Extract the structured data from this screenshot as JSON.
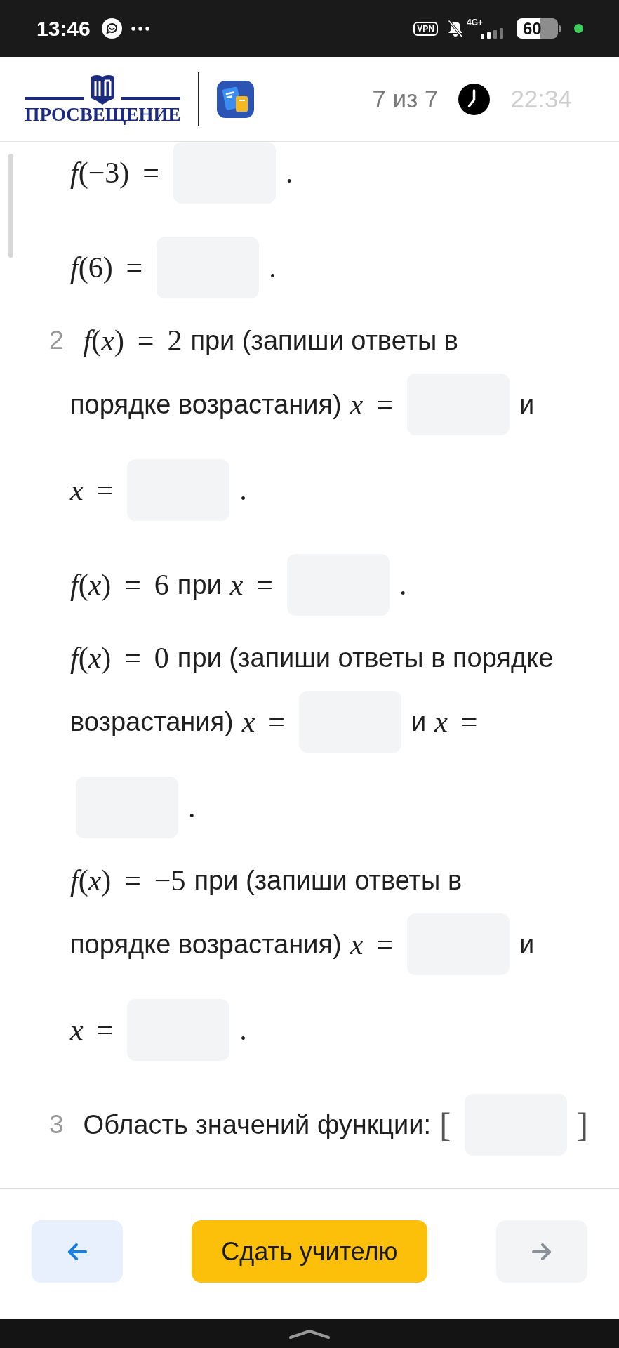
{
  "status_bar": {
    "time": "13:46",
    "vpn": "VPN",
    "network": "4G+",
    "battery": "60"
  },
  "header": {
    "logo_text": "ПРОСВЕЩЕНИЕ",
    "progress": {
      "label": "7 из 7",
      "disabled": true
    },
    "timer": "22:34"
  },
  "questions": [
    {
      "parts": [
        {
          "lines": [
            [
              {
                "kind": "math",
                "text": "*f*(−3) ="
              },
              {
                "kind": "blank"
              },
              {
                "kind": "math",
                "text": "."
              }
            ]
          ]
        },
        {
          "lines": [
            [
              {
                "kind": "math",
                "text": "*f*(6) ="
              },
              {
                "kind": "blank"
              },
              {
                "kind": "math",
                "text": "."
              }
            ]
          ]
        }
      ]
    },
    {
      "number": "2",
      "parts": [
        {
          "lines": [
            [
              {
                "kind": "math",
                "text": "*f*(*x*) = 2"
              },
              {
                "kind": "text",
                "text": "при (запиши ответы в"
              }
            ],
            [
              {
                "kind": "text",
                "text": "порядке возрастания)"
              },
              {
                "kind": "math",
                "text": "*x* ="
              },
              {
                "kind": "blank"
              },
              {
                "kind": "text",
                "text": "и"
              }
            ],
            [
              {
                "kind": "math",
                "text": "*x* ="
              },
              {
                "kind": "blank"
              },
              {
                "kind": "math",
                "text": "."
              }
            ]
          ]
        },
        {
          "lines": [
            [
              {
                "kind": "math",
                "text": "*f*(*x*) = 6"
              },
              {
                "kind": "text",
                "text": "при"
              },
              {
                "kind": "math",
                "text": "*x* ="
              },
              {
                "kind": "blank"
              },
              {
                "kind": "math",
                "text": "."
              }
            ]
          ]
        },
        {
          "lines": [
            [
              {
                "kind": "math",
                "text": "*f*(*x*) = 0"
              },
              {
                "kind": "text",
                "text": "при (запиши ответы в порядке"
              }
            ],
            [
              {
                "kind": "text",
                "text": "возрастания)"
              },
              {
                "kind": "math",
                "text": "*x* ="
              },
              {
                "kind": "blank"
              },
              {
                "kind": "text",
                "text": "и"
              },
              {
                "kind": "math",
                "text": "*x* ="
              }
            ],
            [
              {
                "kind": "blank"
              },
              {
                "kind": "math",
                "text": "."
              }
            ]
          ]
        },
        {
          "lines": [
            [
              {
                "kind": "math",
                "text": "*f*(*x*) = −5"
              },
              {
                "kind": "text",
                "text": "при (запиши ответы в"
              }
            ],
            [
              {
                "kind": "text",
                "text": "порядке возрастания)"
              },
              {
                "kind": "math",
                "text": "*x* ="
              },
              {
                "kind": "blank"
              },
              {
                "kind": "text",
                "text": "и"
              }
            ],
            [
              {
                "kind": "math",
                "text": "*x* ="
              },
              {
                "kind": "blank"
              },
              {
                "kind": "math",
                "text": "."
              }
            ]
          ]
        }
      ]
    },
    {
      "number": "3",
      "parts": [
        {
          "lines": [
            [
              {
                "kind": "text",
                "text": "Область значений функции:"
              },
              {
                "kind": "delimiter",
                "text": "["
              },
              {
                "kind": "blank"
              },
              {
                "kind": "delimiter",
                "text": "]"
              }
            ]
          ]
        }
      ]
    }
  ],
  "footer": {
    "buttons": [
      {
        "kind": "back",
        "disabled": false
      },
      {
        "kind": "submit",
        "label": "Сдать учителю",
        "disabled": false
      },
      {
        "kind": "forward",
        "disabled": true
      }
    ]
  }
}
